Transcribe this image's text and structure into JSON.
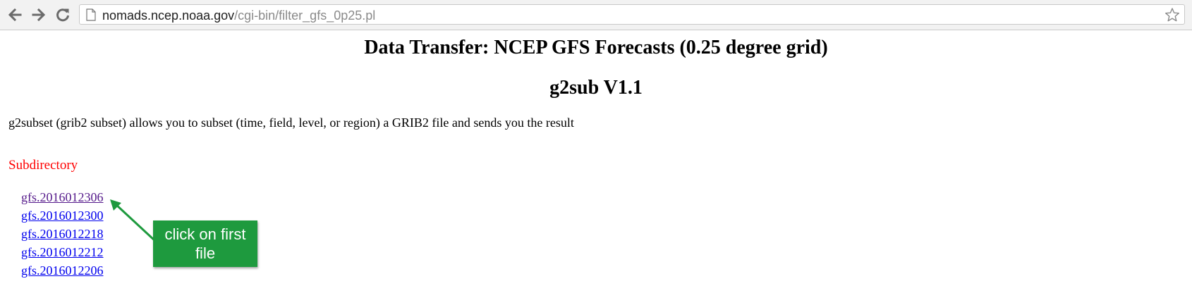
{
  "browser": {
    "url_host": "nomads.ncep.noaa.gov",
    "url_path": "/cgi-bin/filter_gfs_0p25.pl"
  },
  "page": {
    "title": "Data Transfer: NCEP GFS Forecasts (0.25 degree grid)",
    "subtitle": "g2sub V1.1",
    "intro": "g2subset (grib2 subset) allows you to subset (time, field, level, or region) a GRIB2 file and sends you the result",
    "subdirectory_heading": "Subdirectory",
    "files": [
      {
        "label": "gfs.2016012306",
        "visited": true
      },
      {
        "label": "gfs.2016012300",
        "visited": false
      },
      {
        "label": "gfs.2016012218",
        "visited": false
      },
      {
        "label": "gfs.2016012212",
        "visited": false
      },
      {
        "label": "gfs.2016012206",
        "visited": false
      }
    ]
  },
  "annotation": {
    "callout_line1": "click on first",
    "callout_line2": "file",
    "color": "#1e9a3e"
  },
  "colors": {
    "link": "#0000ee",
    "link_visited": "#551a8b",
    "heading_red": "#ff0000"
  },
  "icons": [
    "back-arrow-icon",
    "forward-arrow-icon",
    "reload-icon",
    "page-icon",
    "bookmark-star-icon"
  ]
}
